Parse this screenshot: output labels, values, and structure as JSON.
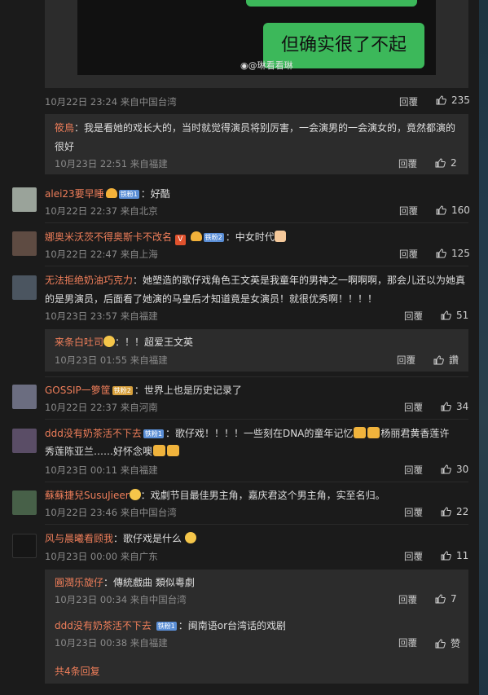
{
  "post_image": {
    "bubble_text": "但确实很了不起",
    "watermark": "@琳看看琳"
  },
  "thread1": {
    "meta": "10月22日 23:24 来自中国台湾",
    "reply": "回覆",
    "likes": "235",
    "replies": [
      {
        "name": "筱鳥",
        "text_line1": "：我是看她的戏长大的，当时就觉得演员将别厉害，一会演男的一会演女的，竟然都演的",
        "text_line2": "很好",
        "meta": "10月23日 22:51 来自福建",
        "reply": "回覆",
        "likes": "2"
      }
    ]
  },
  "comments": [
    {
      "name": "alei23要早睡",
      "badge": "铁粉1",
      "text": "：好酷",
      "meta": "10月22日 22:37 来自北京",
      "reply": "回覆",
      "likes": "160"
    },
    {
      "name": "娜奥米沃茨不得奥斯卡不改名",
      "badge": "铁粉2",
      "text": "：中女时代",
      "meta": "10月22日 22:47 来自上海",
      "reply": "回覆",
      "likes": "125"
    },
    {
      "name": "无法拒绝奶油巧克力",
      "text_line1": "：她塑造的歌仔戏角色王文英是我童年的男神之一啊啊啊，那会儿还以为她真",
      "text_line2": "的是男演员，后面看了她演的马皇后才知道竟是女演员！就很优秀啊！！！！",
      "meta": "10月23日 23:57 来自福建",
      "reply": "回覆",
      "likes": "51",
      "replies": [
        {
          "name": "来条白吐司",
          "text": "：！！超爱王文英",
          "meta": "10月23日 01:55 来自福建",
          "reply": "回覆",
          "likes": "讚"
        }
      ]
    },
    {
      "name": "GOSSIP一箩筐",
      "badge": "铁粉2",
      "text": "：世界上也是历史记录了",
      "meta": "10月22日 22:37 来自河南",
      "reply": "回覆",
      "likes": "34"
    },
    {
      "name": "ddd没有奶茶活不下去",
      "badge": "铁粉1",
      "text_line1": "：歌仔戏！！！！一些刻在DNA的童年记忆",
      "text_line1b": "杨丽君黄香莲许",
      "text_line2": "秀莲陈亚兰……好怀念噢",
      "meta": "10月23日 00:11 来自福建",
      "reply": "回覆",
      "likes": "30"
    },
    {
      "name": "蘇蘇捷兒SusuJieer",
      "text": "：戏劇节目最佳男主角，嘉庆君这个男主角，实至名归。",
      "meta": "10月22日 23:46 来自中国台湾",
      "reply": "回覆",
      "likes": "22"
    },
    {
      "name": "风与晨曦看顾我",
      "text": "：歌仔戏是什么",
      "meta": "10月23日 00:00 来自广东",
      "reply": "回覆",
      "likes": "11",
      "replies": [
        {
          "name": "圓潤乐旋仔",
          "text": "：傳統戲曲 類似粵劇",
          "meta": "10月23日 00:34 来自中国台湾",
          "reply": "回覆",
          "likes": "7"
        },
        {
          "name": "ddd没有奶茶活不下去",
          "badge": "铁粉1",
          "text": "：闽南语or台湾话的戏剧",
          "meta": "10月23日 00:38 来自福建",
          "reply": "回覆",
          "likes": "赞"
        }
      ],
      "more": "共4条回复"
    }
  ]
}
